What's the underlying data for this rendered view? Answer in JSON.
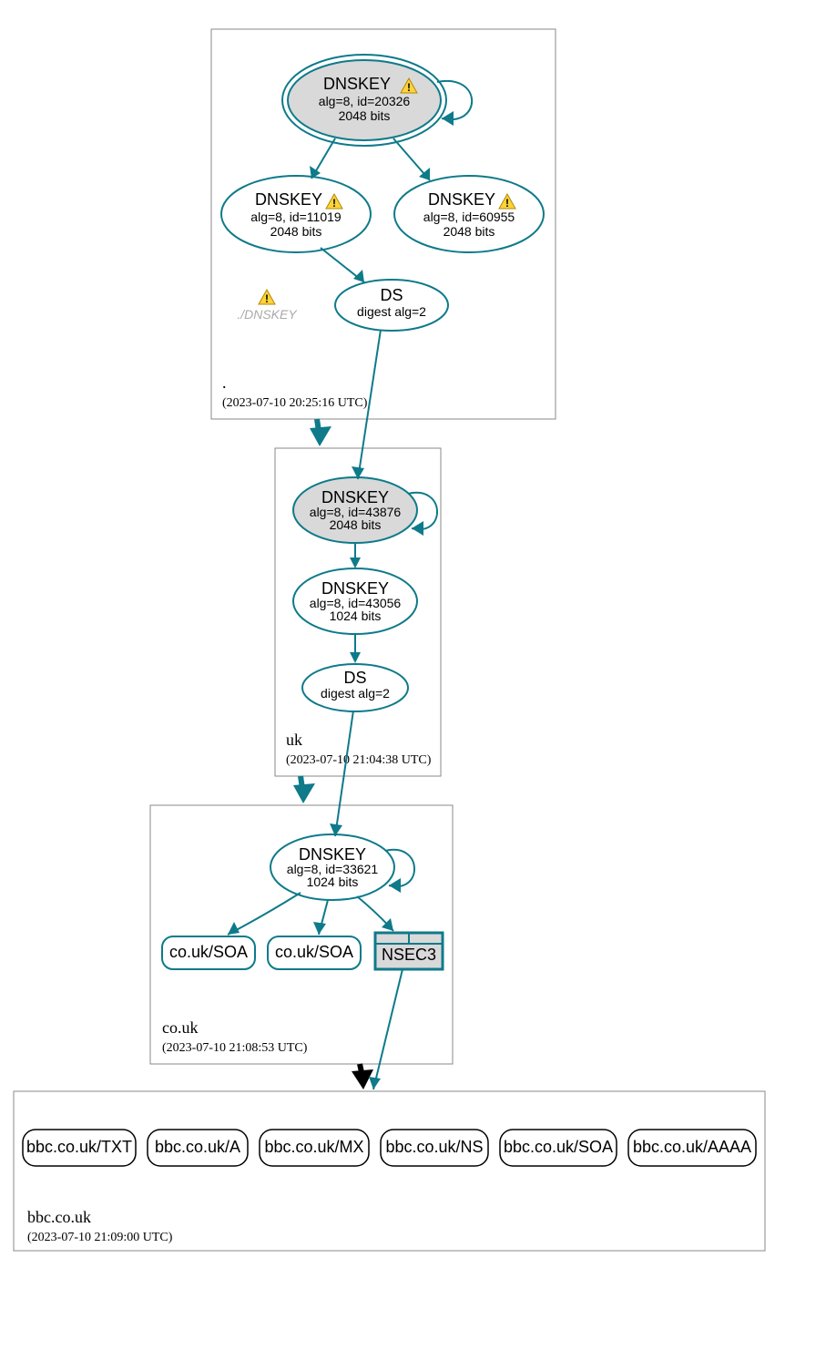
{
  "zones": {
    "root": {
      "name": ".",
      "timestamp": "(2023-07-10 20:25:16 UTC)",
      "ksk": {
        "title": "DNSKEY",
        "line1": "alg=8, id=20326",
        "line2": "2048 bits",
        "warn": true
      },
      "zsk1": {
        "title": "DNSKEY",
        "line1": "alg=8, id=11019",
        "line2": "2048 bits",
        "warn": true
      },
      "zsk2": {
        "title": "DNSKEY",
        "line1": "alg=8, id=60955",
        "line2": "2048 bits",
        "warn": true
      },
      "ds": {
        "title": "DS",
        "line1": "digest alg=2"
      },
      "warn_label": "./DNSKEY"
    },
    "uk": {
      "name": "uk",
      "timestamp": "(2023-07-10 21:04:38 UTC)",
      "ksk": {
        "title": "DNSKEY",
        "line1": "alg=8, id=43876",
        "line2": "2048 bits"
      },
      "zsk": {
        "title": "DNSKEY",
        "line1": "alg=8, id=43056",
        "line2": "1024 bits"
      },
      "ds": {
        "title": "DS",
        "line1": "digest alg=2"
      }
    },
    "couk": {
      "name": "co.uk",
      "timestamp": "(2023-07-10 21:08:53 UTC)",
      "ksk": {
        "title": "DNSKEY",
        "line1": "alg=8, id=33621",
        "line2": "1024 bits"
      },
      "soa1": "co.uk/SOA",
      "soa2": "co.uk/SOA",
      "nsec3": "NSEC3"
    },
    "bbc": {
      "name": "bbc.co.uk",
      "timestamp": "(2023-07-10 21:09:00 UTC)",
      "records": [
        "bbc.co.uk/TXT",
        "bbc.co.uk/A",
        "bbc.co.uk/MX",
        "bbc.co.uk/NS",
        "bbc.co.uk/SOA",
        "bbc.co.uk/AAAA"
      ]
    }
  }
}
